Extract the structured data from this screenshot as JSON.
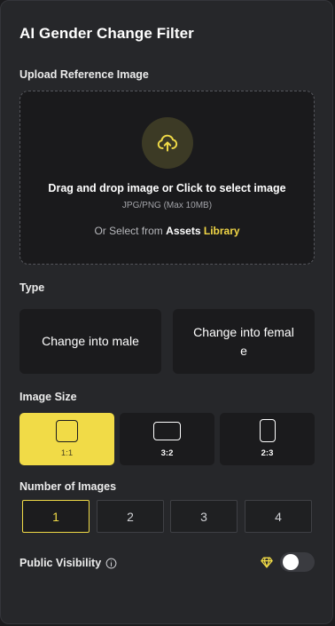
{
  "title": "AI Gender Change Filter",
  "upload": {
    "label": "Upload Reference Image",
    "main_text": "Drag and drop image or Click to select image",
    "sub_text": "JPG/PNG (Max 10MB)",
    "alt_prefix": "Or Select from",
    "alt_link_part1": "Assets",
    "alt_link_part2": "Library",
    "icon": "cloud-upload-icon"
  },
  "type": {
    "label": "Type",
    "options": [
      {
        "label": "Change into male"
      },
      {
        "label_line1": "Change into femal",
        "label_line2": "e"
      }
    ]
  },
  "image_size": {
    "label": "Image Size",
    "options": [
      {
        "label": "1:1",
        "selected": true
      },
      {
        "label": "3:2",
        "selected": false
      },
      {
        "label": "2:3",
        "selected": false
      }
    ]
  },
  "number_of_images": {
    "label": "Number of Images",
    "options": [
      "1",
      "2",
      "3",
      "4"
    ],
    "selected": "1"
  },
  "public_visibility": {
    "label": "Public Visibility",
    "enabled": false,
    "icons": [
      "info-icon",
      "diamond-icon"
    ]
  },
  "colors": {
    "accent": "#f1db47",
    "panel": "#26272a",
    "card": "#1b1b1d"
  }
}
